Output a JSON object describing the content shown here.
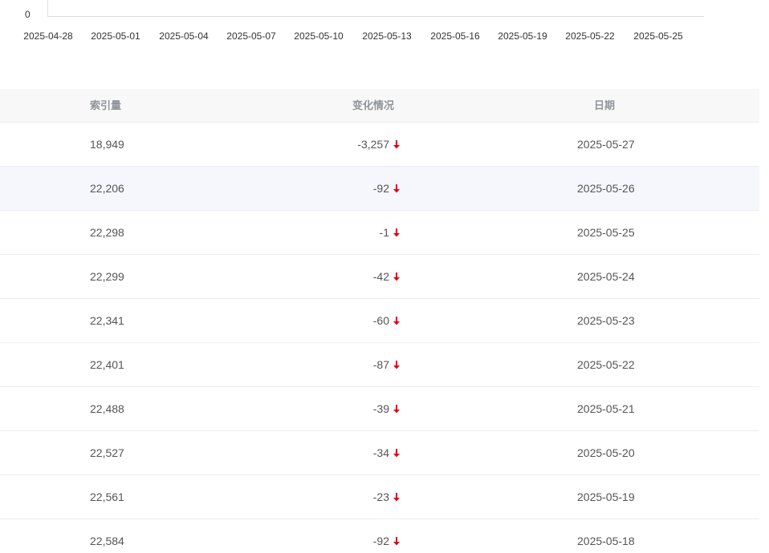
{
  "chart": {
    "y_zero_label": "0",
    "x_ticks": [
      "2025-04-28",
      "2025-05-01",
      "2025-05-04",
      "2025-05-07",
      "2025-05-10",
      "2025-05-13",
      "2025-05-16",
      "2025-05-19",
      "2025-05-22",
      "2025-05-25"
    ]
  },
  "table": {
    "headers": {
      "index": "索引量",
      "change": "变化情况",
      "date": "日期"
    },
    "down_color": "#e60012",
    "trend_icon": "arrow-down-icon",
    "rows": [
      {
        "index": "18,949",
        "change": "-3,257",
        "date": "2025-05-27"
      },
      {
        "index": "22,206",
        "change": "-92",
        "date": "2025-05-26"
      },
      {
        "index": "22,298",
        "change": "-1",
        "date": "2025-05-25"
      },
      {
        "index": "22,299",
        "change": "-42",
        "date": "2025-05-24"
      },
      {
        "index": "22,341",
        "change": "-60",
        "date": "2025-05-23"
      },
      {
        "index": "22,401",
        "change": "-87",
        "date": "2025-05-22"
      },
      {
        "index": "22,488",
        "change": "-39",
        "date": "2025-05-21"
      },
      {
        "index": "22,527",
        "change": "-34",
        "date": "2025-05-20"
      },
      {
        "index": "22,561",
        "change": "-23",
        "date": "2025-05-19"
      },
      {
        "index": "22,584",
        "change": "-92",
        "date": "2025-05-18"
      }
    ]
  }
}
